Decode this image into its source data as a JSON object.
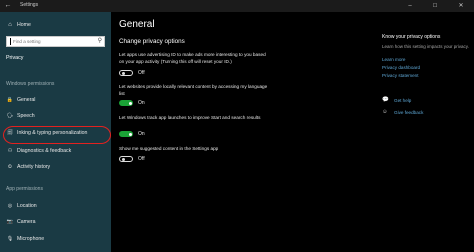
{
  "window": {
    "title": "Settings",
    "back_glyph": "←",
    "minimize_glyph": "–",
    "maximize_glyph": "☐",
    "close_glyph": "✕"
  },
  "sidebar": {
    "home": {
      "label": "Home",
      "icon": "home-icon",
      "glyph": "⌂"
    },
    "search": {
      "placeholder": "Find a setting",
      "icon": "search-icon",
      "glyph": "⚲"
    },
    "privacy_heading": "Privacy",
    "windows_permissions_label": "Windows permissions",
    "windows_items": [
      {
        "label": "General",
        "icon": "lock-icon",
        "glyph": "🔒"
      },
      {
        "label": "Speech",
        "icon": "speech-icon",
        "glyph": "🗣"
      },
      {
        "label": "Inking & typing personalization",
        "icon": "inking-icon",
        "glyph": "🗐"
      },
      {
        "label": "Diagnostics & feedback",
        "icon": "diagnostics-icon",
        "glyph": "⚇"
      },
      {
        "label": "Activity history",
        "icon": "activity-icon",
        "glyph": "⏲"
      }
    ],
    "app_permissions_label": "App permissions",
    "app_items": [
      {
        "label": "Location",
        "icon": "location-icon",
        "glyph": "◎"
      },
      {
        "label": "Camera",
        "icon": "camera-icon",
        "glyph": "📷"
      },
      {
        "label": "Microphone",
        "icon": "microphone-icon",
        "glyph": "🎙"
      }
    ],
    "highlighted_item": "Inking & typing personalization",
    "highlight_color": "#e3211f"
  },
  "main": {
    "title": "General",
    "section_heading": "Change privacy options",
    "options": [
      {
        "description": "Let apps use advertising ID to make ads more interesting to you based on your app activity (Turning this off will reset your ID.)",
        "state": "Off",
        "on": false
      },
      {
        "description": "Let websites provide locally relevant content by accessing my language list",
        "state": "On",
        "on": true
      },
      {
        "description": "Let Windows track app launches to improve Start and search results",
        "state": "On",
        "on": true
      },
      {
        "description": "Show me suggested content in the Settings app",
        "state": "Off",
        "on": false
      }
    ],
    "toggle_on_color": "#1aa336"
  },
  "right_panel": {
    "heading": "Know your privacy options",
    "text": "Learn how this setting impacts your privacy.",
    "links": [
      "Learn more",
      "Privacy dashboard",
      "Privacy statement"
    ],
    "help": [
      {
        "label": "Get help",
        "icon": "help-chat-icon",
        "glyph": "💬"
      },
      {
        "label": "Give feedback",
        "icon": "feedback-icon",
        "glyph": "☺"
      }
    ],
    "link_color": "#5fa8d6"
  }
}
